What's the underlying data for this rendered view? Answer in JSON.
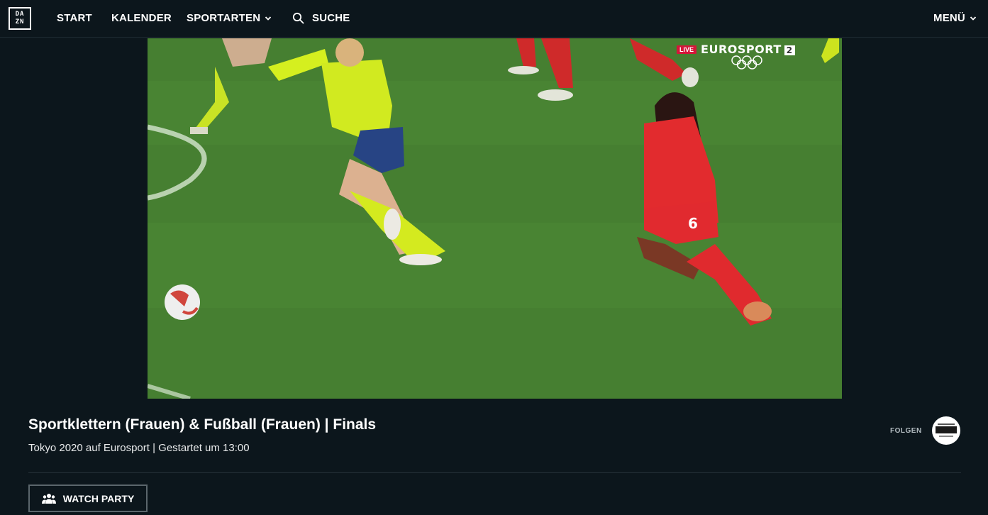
{
  "logo": {
    "line1": "DA",
    "line2": "ZN"
  },
  "nav": {
    "start": "START",
    "kalender": "KALENDER",
    "sportarten": "SPORTARTEN",
    "suche": "SUCHE",
    "menu": "MENÜ"
  },
  "player": {
    "live_label": "LIVE",
    "channel_name": "EUROSPORT",
    "channel_number": "2",
    "player_number": "6"
  },
  "event": {
    "title": "Sportklettern (Frauen) & Fußball (Frauen) | Finals",
    "subtitle": "Tokyo 2020 auf Eurosport | Gestartet um 13:00"
  },
  "follow": {
    "label": "FOLGEN"
  },
  "actions": {
    "watch_party": "WATCH PARTY"
  },
  "colors": {
    "background": "#0c161c",
    "live_red": "#d4173a",
    "button_border": "#5b666c"
  }
}
